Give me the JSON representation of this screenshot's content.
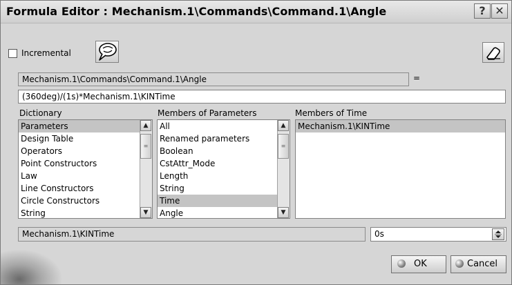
{
  "window": {
    "title": "Formula Editor : Mechanism.1\\Commands\\Command.1\\Angle"
  },
  "titlebar": {
    "help_glyph": "?",
    "close_glyph": "✕"
  },
  "toolbar": {
    "incremental_label": "Incremental",
    "incremental_checked": false
  },
  "parameter": {
    "name": "Mechanism.1\\Commands\\Command.1\\Angle",
    "equals": "="
  },
  "formula": {
    "value": "(360deg)/(1s)*Mechanism.1\\KINTime"
  },
  "dictionary": {
    "header": "Dictionary",
    "items": [
      "Parameters",
      "Design Table",
      "Operators",
      "Point Constructors",
      "Law",
      "Line Constructors",
      "Circle Constructors",
      "String"
    ],
    "selected": "Parameters"
  },
  "members_parameters": {
    "header": "Members of Parameters",
    "items": [
      "All",
      "Renamed parameters",
      "Boolean",
      "CstAttr_Mode",
      "Length",
      "String",
      "Time",
      "Angle"
    ],
    "selected": "Time"
  },
  "members_time": {
    "header": "Members of Time",
    "items": [
      "Mechanism.1\\KINTime"
    ],
    "selected": "Mechanism.1\\KINTime"
  },
  "bottom": {
    "selected_member": "Mechanism.1\\KINTime",
    "value": "0s"
  },
  "buttons": {
    "ok": "OK",
    "cancel": "Cancel"
  }
}
